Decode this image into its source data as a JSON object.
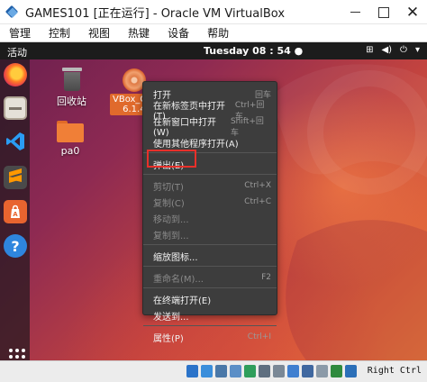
{
  "window": {
    "title": "GAMES101 [正在运行] - Oracle VM VirtualBox",
    "minimize_glyph": "",
    "maximize_glyph": "",
    "close_glyph": "✕"
  },
  "menubar": {
    "items": [
      "管理",
      "控制",
      "视图",
      "热键",
      "设备",
      "帮助"
    ]
  },
  "topbar": {
    "activities": "活动",
    "clock": "Tuesday 08 : 54 ●",
    "tray": {
      "network": "⊞",
      "sound": "◀)",
      "power": "⏻",
      "menu": "▾"
    }
  },
  "desktop": {
    "icons": [
      {
        "label": "回收站",
        "icon": "trash-icon"
      },
      {
        "label": "pa0",
        "icon": "folder-icon"
      },
      {
        "label": "VBox_GAs_\n6.1.4",
        "label_line1": "VBox_G...",
        "label_line2": "6.1.4",
        "icon": "disc-icon"
      }
    ]
  },
  "dock": {
    "items": [
      "firefox-icon",
      "files-icon",
      "vscode-icon",
      "sublime-icon",
      "software-icon",
      "help-icon"
    ],
    "help_glyph": "?",
    "show_apps": "show-applications-icon"
  },
  "context_menu": {
    "items": [
      {
        "label": "打开",
        "shortcut": "回车",
        "enabled": true
      },
      {
        "label": "在新标签页中打开(T)",
        "shortcut": "Ctrl+回车",
        "enabled": true
      },
      {
        "label": "在新窗口中打开(W)",
        "shortcut": "Shift+回车",
        "enabled": true
      },
      {
        "label": "使用其他程序打开(A)",
        "shortcut": "",
        "enabled": true
      },
      {
        "label": "弹出(E)",
        "shortcut": "",
        "enabled": true
      },
      {
        "label": "剪切(T)",
        "shortcut": "Ctrl+X",
        "enabled": false
      },
      {
        "label": "复制(C)",
        "shortcut": "Ctrl+C",
        "enabled": false
      },
      {
        "label": "移动到...",
        "shortcut": "",
        "enabled": false
      },
      {
        "label": "复制到...",
        "shortcut": "",
        "enabled": false
      },
      {
        "label": "缩放图标...",
        "shortcut": "",
        "enabled": true
      },
      {
        "label": "重命名(M)...",
        "shortcut": "F2",
        "enabled": false
      },
      {
        "label": "在终端打开(E)",
        "shortcut": "",
        "enabled": true
      },
      {
        "label": "发送到...",
        "shortcut": "",
        "enabled": true
      },
      {
        "label": "属性(P)",
        "shortcut": "Ctrl+I",
        "enabled": true
      }
    ]
  },
  "statusbar": {
    "host_key": "Right Ctrl",
    "icon_colors": [
      "#2b73c9",
      "#3a8edb",
      "#4a78a8",
      "#5b8fc7",
      "#2f9e5b",
      "#5f6f80",
      "#7a8896",
      "#3f7fd0",
      "#4068a0",
      "#8b9aa8",
      "#2f8a3e",
      "#2b6fb8"
    ]
  }
}
